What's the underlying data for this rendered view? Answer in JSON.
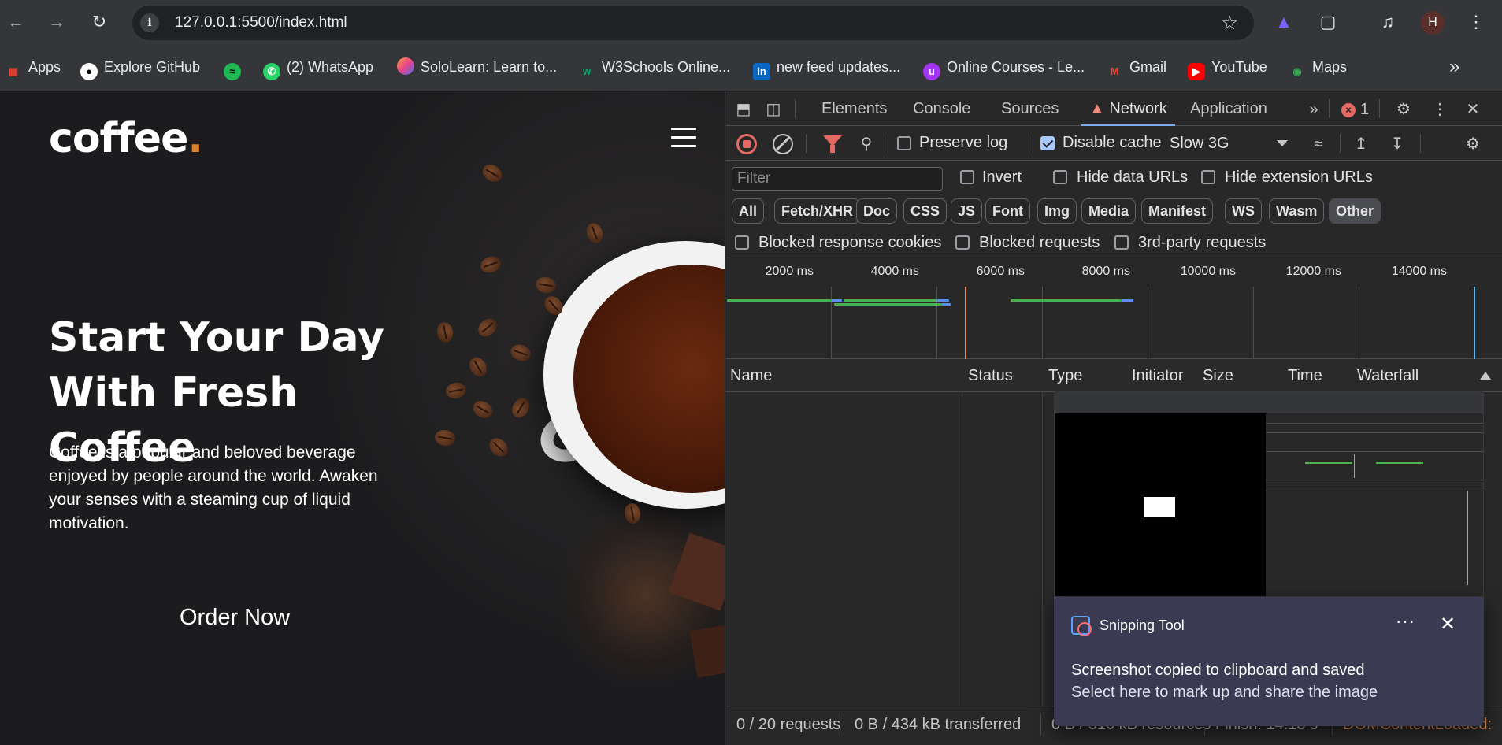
{
  "browser": {
    "url": "127.0.0.1:5500/index.html",
    "avatar_letter": "H",
    "bookmarks": [
      {
        "label": "Apps",
        "icon": "apps-grid-icon",
        "color": "#ea4335"
      },
      {
        "label": "Explore GitHub",
        "icon": "github-icon",
        "color": "#ffffff"
      },
      {
        "label": "",
        "icon": "spotify-icon",
        "color": "#1db954"
      },
      {
        "label": "(2) WhatsApp",
        "icon": "whatsapp-icon",
        "color": "#25d366"
      },
      {
        "label": "SoloLearn: Learn to...",
        "icon": "sololearn-icon",
        "color": "#f7a13b"
      },
      {
        "label": "W3Schools Online...",
        "icon": "w3schools-icon",
        "color": "#04aa6d"
      },
      {
        "label": "new feed updates...",
        "icon": "linkedin-icon",
        "color": "#0a66c2"
      },
      {
        "label": "Online Courses - Le...",
        "icon": "udemy-icon",
        "color": "#a435f0"
      },
      {
        "label": "Gmail",
        "icon": "gmail-icon",
        "color": "#ea4335"
      },
      {
        "label": "YouTube",
        "icon": "youtube-icon",
        "color": "#ff0000"
      },
      {
        "label": "Maps",
        "icon": "maps-icon",
        "color": "#34a853"
      }
    ]
  },
  "site": {
    "logo": "coffee",
    "logo_dot": ".",
    "hero_title": "Start Your Day With Fresh Coffee",
    "hero_text": "Coffee is a popular and beloved beverage enjoyed by people around the world. Awaken your senses with a steaming cup of liquid motivation.",
    "cta": "Order Now"
  },
  "devtools": {
    "tabs": [
      "Elements",
      "Console",
      "Sources",
      "Network",
      "Application"
    ],
    "active_tab": "Network",
    "error_count": "1",
    "preserve_log": "Preserve log",
    "disable_cache": "Disable cache",
    "throttling": "Slow 3G",
    "filter_placeholder": "Filter",
    "invert": "Invert",
    "hide_data_urls": "Hide data URLs",
    "hide_extension_urls": "Hide extension URLs",
    "type_filters": [
      "All",
      "Fetch/XHR",
      "Doc",
      "CSS",
      "JS",
      "Font",
      "Img",
      "Media",
      "Manifest",
      "WS",
      "Wasm",
      "Other"
    ],
    "selected_type": "Other",
    "blocked_response_cookies": "Blocked response cookies",
    "blocked_requests": "Blocked requests",
    "third_party_requests": "3rd-party requests",
    "timeline_ticks": [
      "2000 ms",
      "4000 ms",
      "6000 ms",
      "8000 ms",
      "10000 ms",
      "12000 ms",
      "14000 ms"
    ],
    "columns": [
      "Name",
      "Status",
      "Type",
      "Initiator",
      "Size",
      "Time",
      "Waterfall"
    ],
    "status": {
      "requests": "0 / 20 requests",
      "transferred": "0 B / 434 kB transferred",
      "resources": "0 B / 516 kB resources",
      "finish": "Finish: 14.13 s",
      "dcl": "DOMContentLoaded:"
    },
    "colors": {
      "accent": "#7cacf8",
      "error": "#e46962",
      "dcl_line": "#e0905a",
      "load_line": "#5fb4e8"
    }
  },
  "toast": {
    "app": "Snipping Tool",
    "more": "···",
    "title": "Screenshot copied to clipboard and saved",
    "body": "Select here to mark up and share the image"
  }
}
